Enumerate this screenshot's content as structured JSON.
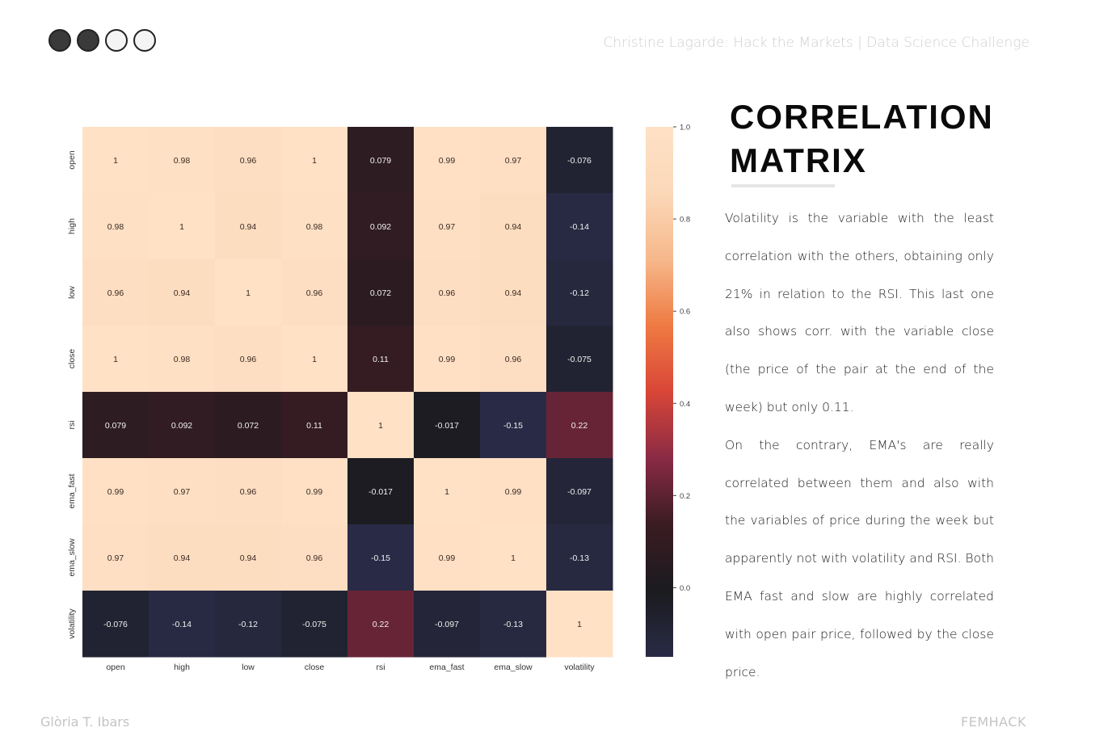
{
  "header": {
    "title": "Christine Lagarde: Hack the Markets | Data Science Challenge"
  },
  "progress_dots": {
    "filled": 2,
    "total": 4
  },
  "footer": {
    "author": "Glòria T. Ibars",
    "brand": "FEMHACK"
  },
  "slide": {
    "heading_line1": "CORRELATION",
    "heading_line2": "MATRIX",
    "paragraph1": "Volatility is the variable with the least correlation with the others, obtaining only 21% in relation to the RSI. This last one also shows corr. with the variable close (the price of the pair at the end of the week) but only 0.11.",
    "paragraph2": "On the contrary, EMA's are really correlated between them and also with the variables of price during the week but apparently not with volatility and RSI. Both EMA fast and slow are highly correlated with open pair price, followed by the close price."
  },
  "chart_data": {
    "type": "heatmap",
    "labels": [
      "open",
      "high",
      "low",
      "close",
      "rsi",
      "ema_fast",
      "ema_slow",
      "volatility"
    ],
    "values": [
      [
        1,
        0.98,
        0.96,
        1,
        0.079,
        0.99,
        0.97,
        -0.076
      ],
      [
        0.98,
        1,
        0.94,
        0.98,
        0.092,
        0.97,
        0.94,
        -0.14
      ],
      [
        0.96,
        0.94,
        1,
        0.96,
        0.072,
        0.96,
        0.94,
        -0.12
      ],
      [
        1,
        0.98,
        0.96,
        1,
        0.11,
        0.99,
        0.96,
        -0.075
      ],
      [
        0.079,
        0.092,
        0.072,
        0.11,
        1,
        -0.017,
        -0.15,
        0.22
      ],
      [
        0.99,
        0.97,
        0.96,
        0.99,
        -0.017,
        1,
        0.99,
        -0.097
      ],
      [
        0.97,
        0.94,
        0.94,
        0.96,
        -0.15,
        0.99,
        1,
        -0.13
      ],
      [
        -0.076,
        -0.14,
        -0.12,
        -0.075,
        0.22,
        -0.097,
        -0.13,
        1
      ]
    ],
    "colorbar": {
      "min": -0.15,
      "max": 1.0,
      "ticks": [
        1.0,
        0.8,
        0.6,
        0.4,
        0.2,
        0.0
      ]
    },
    "colormap": "rocket",
    "colormap_stops": [
      "#292b46",
      "#1b1b1f",
      "#3a1c23",
      "#8a2a45",
      "#d94637",
      "#ef7a42",
      "#f6b88b",
      "#fbd8b8",
      "#ffe1c6"
    ]
  }
}
